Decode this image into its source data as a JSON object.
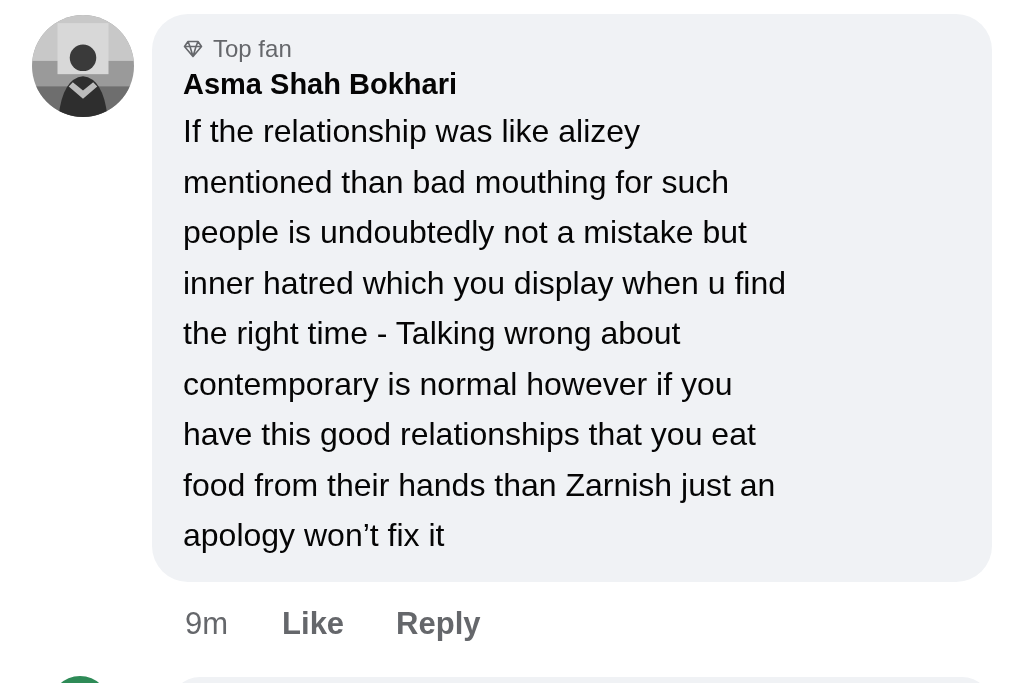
{
  "comment": {
    "badge": "Top fan",
    "author": "Asma Shah Bokhari",
    "body_lines": [
      "If the relationship was like alizey",
      "mentioned than bad mouthing for such",
      "people is undoubtedly not a mistake but",
      "inner hatred which you display when u find",
      "the right time - Talking wrong about",
      "contemporary is normal however if you",
      "have this good relationships that you eat",
      "food from their hands than Zarnish just an",
      "apology won’t fix it"
    ],
    "time": "9m",
    "actions": [
      "Like",
      "Reply"
    ]
  }
}
